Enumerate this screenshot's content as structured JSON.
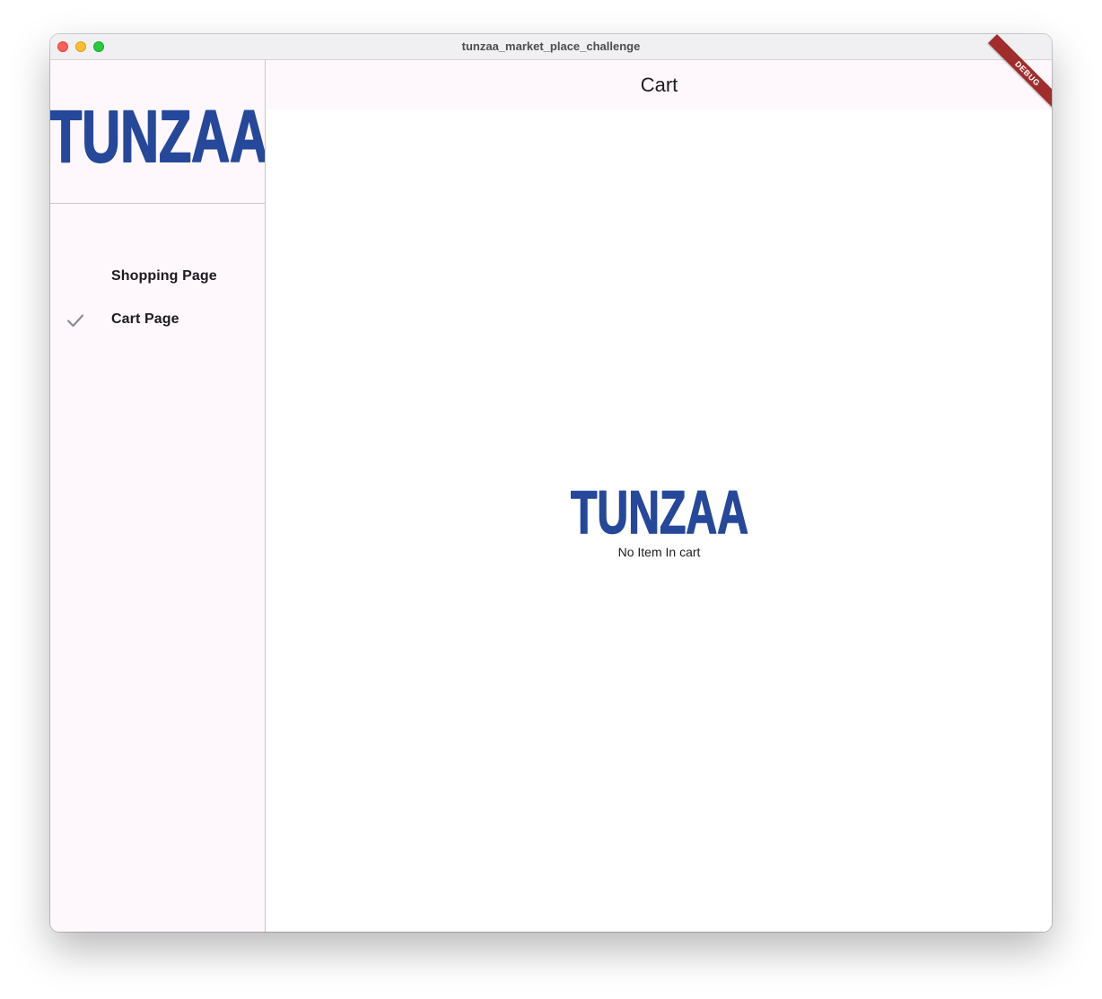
{
  "window": {
    "title": "tunzaa_market_place_challenge"
  },
  "brand": {
    "logo_text": "TUNZAA",
    "color": "#26489a"
  },
  "sidebar": {
    "items": [
      {
        "label": "Shopping Page",
        "selected": false
      },
      {
        "label": "Cart Page",
        "selected": true,
        "icon": "check-icon"
      }
    ]
  },
  "appbar": {
    "title": "Cart",
    "debug_banner": "DEBUG"
  },
  "cart": {
    "empty_message": "No Item In cart"
  }
}
